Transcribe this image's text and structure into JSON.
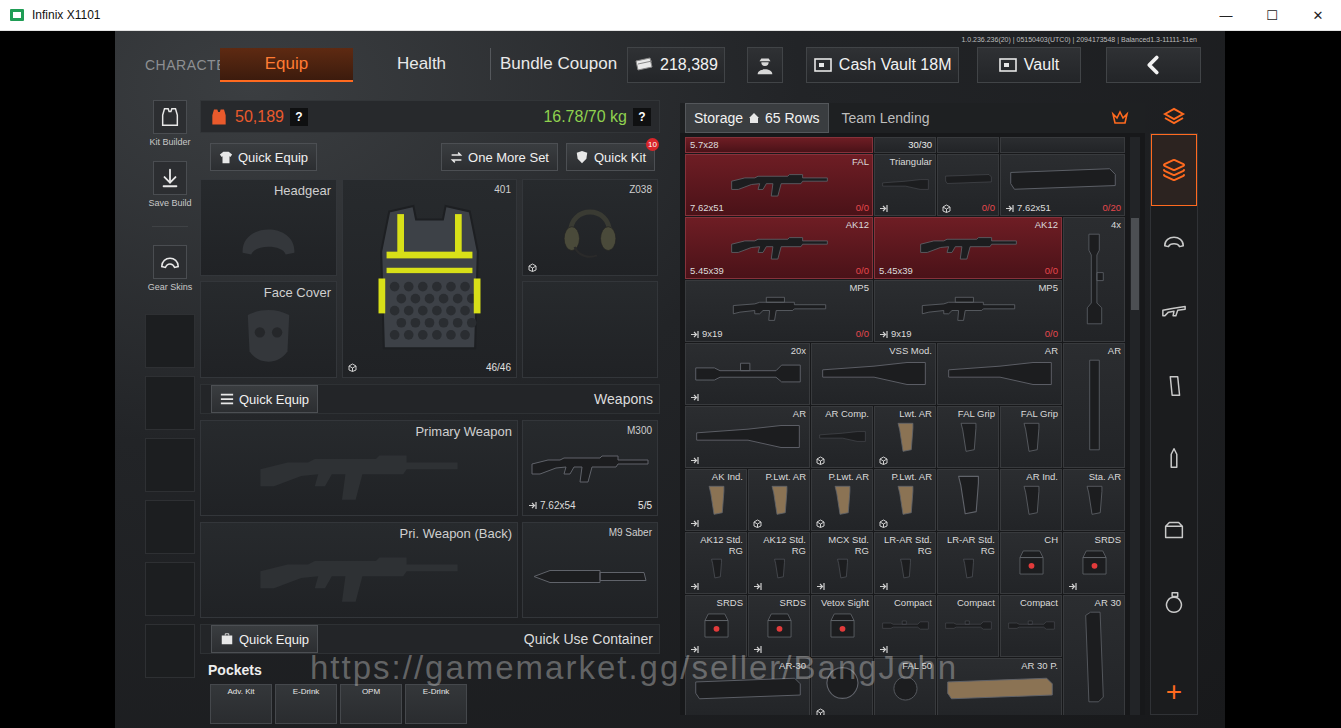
{
  "window": {
    "title": "Infinix X1101",
    "controls": [
      "—",
      "☐",
      "✕"
    ]
  },
  "version": "1.0.236.236(20) | 05150403(UTC0) | 2094173548 | Balanced1.3-11111-11en",
  "nav": {
    "heading": "CHARACTER",
    "tabs": [
      {
        "label": "Equip",
        "selected": true
      },
      {
        "label": "Health",
        "selected": false
      },
      {
        "label": "Bundle Coupon",
        "selected": false
      }
    ]
  },
  "cash": "218,389",
  "vaults": [
    {
      "label": "Cash Vault 18M",
      "kind": "cash"
    },
    {
      "label": "Vault",
      "kind": "vault"
    }
  ],
  "tools": [
    {
      "label": "Kit Builder",
      "kind": "kit"
    },
    {
      "label": "Save Build",
      "kind": "save"
    },
    {
      "label": "Gear Skins",
      "kind": "skins"
    }
  ],
  "toolSlots": [
    {
      "filled": false
    },
    {
      "filled": false
    },
    {
      "filled": false
    },
    {
      "filled": false
    },
    {
      "filled": false
    },
    {
      "filled": false
    }
  ],
  "loadout": {
    "value": "50,189",
    "weight": "16.78/70 kg",
    "help": "?"
  },
  "actions": {
    "quickEquip": "Quick Equip",
    "oneMoreSet": "One More Set",
    "quickKit": "Quick Kit",
    "quickKitBadge": "10"
  },
  "gear": {
    "headgear": "Headgear",
    "faceCover": "Face Cover",
    "vest": {
      "code": "401",
      "durability": "46/46",
      "mark": "cube"
    },
    "headset": {
      "code": "Z038",
      "mark": "cube"
    }
  },
  "weapons": {
    "title": "Weapons",
    "quickEquip": "Quick Equip",
    "slots": [
      {
        "label": "Primary Weapon",
        "item": {
          "name": "M300",
          "caliber": "7.62x54",
          "count": "5/5",
          "kind": "rifle",
          "mark": "in"
        }
      },
      {
        "label": "Pri. Weapon (Back)",
        "item": {
          "name": "M9 Saber",
          "kind": "knife",
          "mark": "none"
        }
      }
    ]
  },
  "quickUse": {
    "title": "Quick Use Container",
    "quickEquip": "Quick Equip"
  },
  "pockets": {
    "title": "Pockets",
    "items": [
      "Adv. Kit",
      "E-Drink",
      "OPM",
      "E-Drink"
    ]
  },
  "storage": {
    "tabs": [
      {
        "label": "Storage",
        "rows": "65 Rows",
        "selected": true
      },
      {
        "label": "Team Lending",
        "selected": false
      }
    ],
    "scroll": {
      "level": 0.14
    },
    "items": [
      {
        "kind": "rifle",
        "w": 3,
        "h": 1,
        "red": true,
        "caliber": "5.7x28"
      },
      {
        "kind": "mag",
        "w": 1,
        "h": 1,
        "count": "30/30",
        "ammoEmpty": false
      },
      {
        "kind": "stock",
        "w": 1,
        "h": 1
      },
      {
        "kind": "rifle",
        "w": 2,
        "h": 1
      },
      {
        "name": "FAL",
        "kind": "rifle",
        "w": 3,
        "h": 1,
        "red": true,
        "caliber": "7.62x51",
        "count": "0/0",
        "ammoEmpty": true
      },
      {
        "name": "Triangular",
        "kind": "stock",
        "w": 1,
        "h": 1,
        "mark": "in"
      },
      {
        "kind": "mag",
        "w": 1,
        "h": 1,
        "count": "0/0",
        "ammoEmpty": true,
        "mark": "cube"
      },
      {
        "kind": "mag",
        "w": 2,
        "h": 1,
        "caliber": "7.62x51",
        "count": "0/20",
        "ammoEmpty": true,
        "mark": "in"
      },
      {
        "name": "AK12",
        "kind": "rifle",
        "w": 3,
        "h": 1,
        "red": true,
        "caliber": "5.45x39",
        "count": "0/0",
        "ammoEmpty": true
      },
      {
        "name": "AK12",
        "kind": "rifle",
        "w": 3,
        "h": 1,
        "red": true,
        "caliber": "5.45x39",
        "count": "0/0",
        "ammoEmpty": true
      },
      {
        "name": "4x",
        "kind": "scope",
        "w": 1,
        "h": 2
      },
      {
        "name": "MP5",
        "kind": "smg",
        "w": 3,
        "h": 1,
        "caliber": "9x19",
        "count": "0/0",
        "ammoEmpty": true,
        "mark": "in"
      },
      {
        "name": "MP5",
        "kind": "smg",
        "w": 3,
        "h": 1,
        "caliber": "9x19",
        "count": "0/0",
        "ammoEmpty": true,
        "mark": "in"
      },
      {
        "name": "20x",
        "kind": "scope",
        "w": 2,
        "h": 1,
        "mark": "in"
      },
      {
        "name": "VSS Mod.",
        "kind": "stock",
        "w": 2,
        "h": 1
      },
      {
        "name": "AR",
        "kind": "stock",
        "w": 2,
        "h": 1
      },
      {
        "name": "AR",
        "kind": "tube",
        "w": 1,
        "h": 2
      },
      {
        "name": "AR",
        "kind": "stock",
        "w": 2,
        "h": 1,
        "mark": "in"
      },
      {
        "name": "AR Comp.",
        "kind": "stock",
        "w": 1,
        "h": 1,
        "mark": "cube"
      },
      {
        "name": "Lwt. AR",
        "kind": "grip",
        "w": 1,
        "h": 1,
        "mark": "cube",
        "color": "#8b7354"
      },
      {
        "name": "FAL Grip",
        "kind": "grip",
        "w": 1,
        "h": 1
      },
      {
        "name": "FAL Grip",
        "kind": "grip",
        "w": 1,
        "h": 1
      },
      {
        "name": "AK Ind.",
        "kind": "grip",
        "w": 1,
        "h": 1,
        "mark": "in",
        "color": "#8b7354"
      },
      {
        "name": "P.Lwt. AR",
        "kind": "grip",
        "w": 1,
        "h": 1,
        "mark": "cube",
        "color": "#8b7354"
      },
      {
        "name": "P.Lwt. AR",
        "kind": "grip",
        "w": 1,
        "h": 1,
        "mark": "cube",
        "color": "#8b7354"
      },
      {
        "name": "P.Lwt. AR",
        "kind": "grip",
        "w": 1,
        "h": 1,
        "mark": "cube",
        "color": "#8b7354"
      },
      {
        "kind": "grip",
        "w": 1,
        "h": 1
      },
      {
        "name": "AR Ind.",
        "kind": "grip",
        "w": 1,
        "h": 1
      },
      {
        "name": "Sta. AR",
        "kind": "grip",
        "w": 1,
        "h": 1
      },
      {
        "name": "AK12 Std. RG",
        "kind": "grip",
        "w": 1,
        "h": 1,
        "mark": "in"
      },
      {
        "name": "AK12 Std. RG",
        "kind": "grip",
        "w": 1,
        "h": 1,
        "mark": "in"
      },
      {
        "name": "MCX Std. RG",
        "kind": "grip",
        "w": 1,
        "h": 1,
        "mark": "in"
      },
      {
        "name": "LR-AR Std. RG",
        "kind": "grip",
        "w": 1,
        "h": 1,
        "mark": "in"
      },
      {
        "name": "LR-AR Std. RG",
        "kind": "grip",
        "w": 1,
        "h": 1
      },
      {
        "name": "CH",
        "kind": "sight",
        "w": 1,
        "h": 1
      },
      {
        "name": "SRDS",
        "kind": "sight",
        "w": 1,
        "h": 1,
        "mark": "in"
      },
      {
        "name": "SRDS",
        "kind": "sight",
        "w": 1,
        "h": 1,
        "mark": "in"
      },
      {
        "name": "SRDS",
        "kind": "sight",
        "w": 1,
        "h": 1,
        "mark": "in"
      },
      {
        "name": "Vetox Sight",
        "kind": "sight",
        "w": 1,
        "h": 1
      },
      {
        "name": "Compact",
        "kind": "scope",
        "w": 1,
        "h": 1,
        "mark": "in"
      },
      {
        "name": "Compact",
        "kind": "scope",
        "w": 1,
        "h": 1
      },
      {
        "name": "Compact",
        "kind": "scope",
        "w": 1,
        "h": 1
      },
      {
        "name": "AR 30",
        "kind": "mag",
        "w": 1,
        "h": 2
      },
      {
        "name": "AR-30",
        "kind": "mag",
        "w": 2,
        "h": 1
      },
      {
        "kind": "round",
        "w": 1,
        "h": 1,
        "mark": "cube"
      },
      {
        "name": "FAL 50",
        "kind": "round",
        "w": 1,
        "h": 1
      },
      {
        "name": "AR 30 P.",
        "kind": "mag",
        "w": 2,
        "h": 1,
        "color": "#8b7354"
      }
    ]
  },
  "categories": [
    {
      "kind": "all",
      "selected": true
    },
    {
      "kind": "helmet",
      "selected": false
    },
    {
      "kind": "rifle",
      "selected": false
    },
    {
      "kind": "mag",
      "selected": false
    },
    {
      "kind": "ammo",
      "selected": false
    },
    {
      "kind": "sight",
      "selected": false
    },
    {
      "kind": "grenade",
      "selected": false
    }
  ],
  "addButton": "+",
  "watermark": "https://gamemarket.gg/seller/BangJohn"
}
